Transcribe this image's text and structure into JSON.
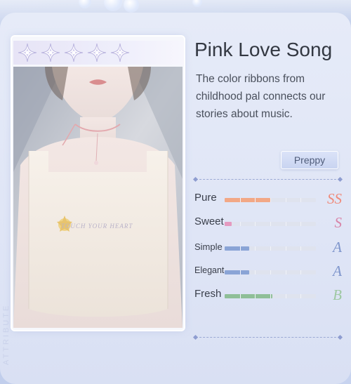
{
  "card": {
    "rarity_stars": 5,
    "side_label": "ATTRIBUTE",
    "shirt_print": "TOUCH YOUR HEART"
  },
  "item": {
    "name": "Pink Love Song",
    "description": "The color ribbons from childhood pal connects our stories about music.",
    "style_tag": "Preppy"
  },
  "attributes": [
    {
      "name": "Pure",
      "grade": "SS",
      "level": 0.5,
      "color": "#f2a886",
      "grade_color": "#ef8a7a"
    },
    {
      "name": "Sweet",
      "grade": "S",
      "level": 0.08,
      "color": "#e59ac0",
      "grade_color": "#d883a7"
    },
    {
      "name": "Simple",
      "grade": "A",
      "level": 0.27,
      "color": "#8aa4d6",
      "grade_color": "#7e95cc"
    },
    {
      "name": "Elegant",
      "grade": "A",
      "level": 0.27,
      "color": "#8aa4d6",
      "grade_color": "#7e95cc"
    },
    {
      "name": "Fresh",
      "grade": "B",
      "level": 0.52,
      "color": "#8fbf98",
      "grade_color": "#9ec8a2"
    }
  ]
}
